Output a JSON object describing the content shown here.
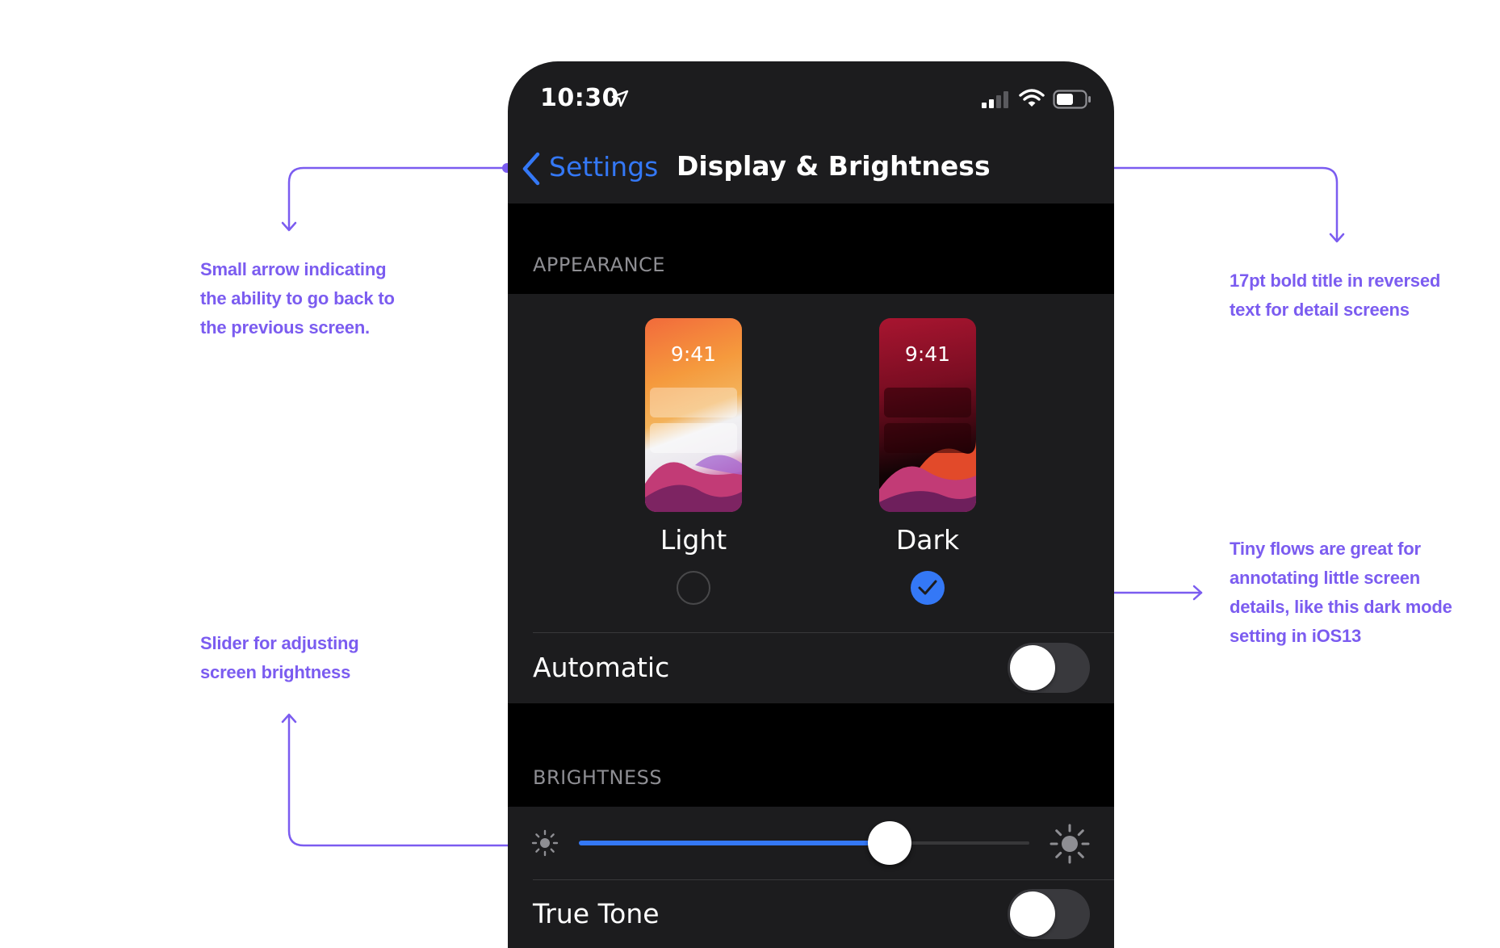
{
  "status_bar": {
    "time": "10:30"
  },
  "nav": {
    "back_label": "Settings",
    "title": "Display & Brightness"
  },
  "appearance": {
    "header": "APPEARANCE",
    "options": [
      {
        "label": "Light",
        "preview_time": "9:41",
        "selected": false
      },
      {
        "label": "Dark",
        "preview_time": "9:41",
        "selected": true
      }
    ],
    "automatic_label": "Automatic",
    "automatic_on": false
  },
  "brightness": {
    "header": "BRIGHTNESS",
    "level": 0.69,
    "true_tone_label": "True Tone",
    "true_tone_on": false
  },
  "annotations": {
    "back_arrow": [
      "Small arrow indicating",
      "the ability to go back to",
      "the previous screen."
    ],
    "title": [
      "17pt bold title in reversed",
      "text for detail screens"
    ],
    "dark_mode": [
      "Tiny flows are great for",
      "annotating little screen",
      "details, like this dark mode",
      "setting in iOS13"
    ],
    "slider": [
      "Slider for  adjusting",
      "screen brightness"
    ]
  },
  "colors": {
    "accent": "#3478f6",
    "annotation": "#7b5cf0",
    "background": "#1c1c1e"
  }
}
